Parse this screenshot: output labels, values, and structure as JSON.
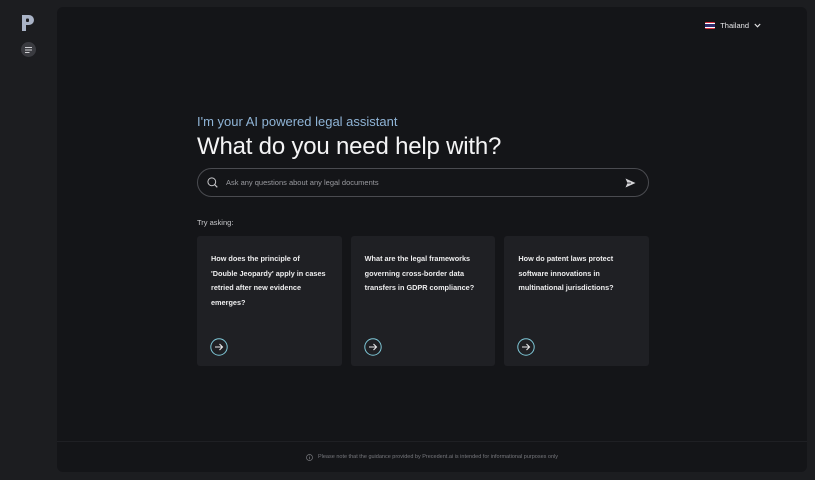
{
  "language": {
    "label": "Thailand"
  },
  "hero": {
    "subtitle": "I'm your AI powered legal assistant",
    "title": "What do you need help with?"
  },
  "search": {
    "placeholder": "Ask any questions about any legal documents"
  },
  "suggestions": {
    "heading": "Try asking:",
    "cards": [
      {
        "text": "How does the principle of 'Double Jeopardy' apply in cases retried after new evidence emerges?"
      },
      {
        "text": "What are the legal frameworks governing cross-border data transfers in GDPR compliance?"
      },
      {
        "text": "How do patent laws protect software innovations in multinational jurisdictions?"
      }
    ]
  },
  "footer": {
    "disclaimer": "Please note that the guidance provided by Precedent.ai is intended for informational purposes only"
  },
  "colors": {
    "accent": "#8fb4d6",
    "arrow": "#7fc8d8",
    "background": "#141518"
  }
}
